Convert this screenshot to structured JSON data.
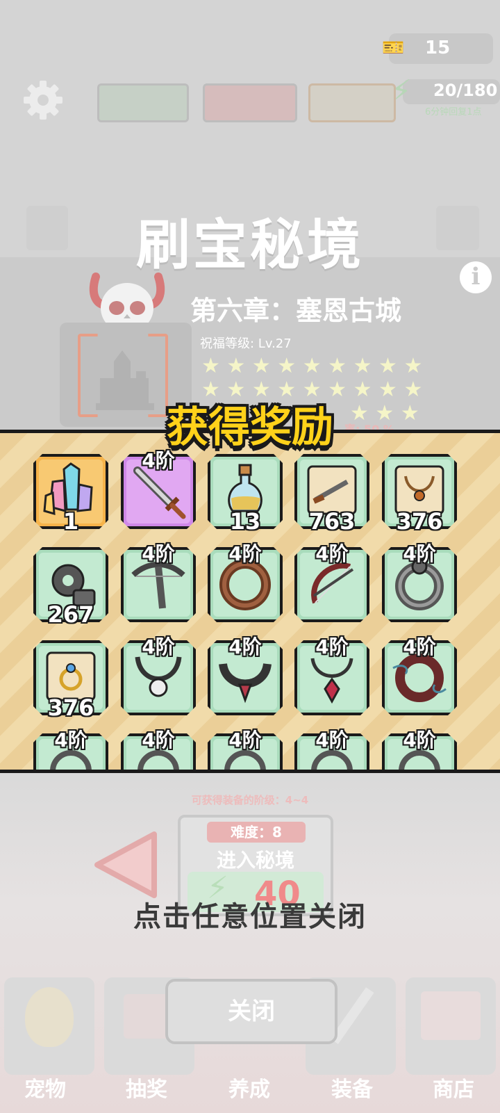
{
  "header": {
    "ticket_count": "15",
    "energy": "20/180",
    "energy_regen": "6分钟回复1点"
  },
  "dungeon": {
    "title": "刷宝秘境",
    "chapter": "第六章：塞恩古城",
    "blessing": "祝福等级: Lv.27",
    "drop_rate_partial": "率: 50 %"
  },
  "reward": {
    "title": "获得奖励",
    "items": [
      {
        "icon": "crystal-cluster-icon",
        "style": "orange",
        "tier": "",
        "count": "1"
      },
      {
        "icon": "sword-icon",
        "style": "purple",
        "tier": "4阶",
        "count": ""
      },
      {
        "icon": "potion-bottle-icon",
        "style": "green",
        "tier": "",
        "count": "13"
      },
      {
        "icon": "dagger-scroll-icon",
        "style": "green",
        "tier": "",
        "count": "763"
      },
      {
        "icon": "necklace-scroll-icon",
        "style": "green",
        "tier": "",
        "count": "376"
      },
      {
        "icon": "gear-material-icon",
        "style": "green",
        "tier": "",
        "count": "267"
      },
      {
        "icon": "crossbow-icon",
        "style": "green",
        "tier": "4阶",
        "count": ""
      },
      {
        "icon": "ring-icon",
        "style": "green",
        "tier": "4阶",
        "count": ""
      },
      {
        "icon": "bow-icon",
        "style": "green",
        "tier": "4阶",
        "count": ""
      },
      {
        "icon": "iron-ring-icon",
        "style": "green",
        "tier": "4阶",
        "count": ""
      },
      {
        "icon": "ring-scroll-icon",
        "style": "green",
        "tier": "",
        "count": "376"
      },
      {
        "icon": "skull-necklace-icon",
        "style": "green",
        "tier": "4阶",
        "count": ""
      },
      {
        "icon": "collar-necklace-icon",
        "style": "green",
        "tier": "4阶",
        "count": ""
      },
      {
        "icon": "ruby-necklace-icon",
        "style": "green",
        "tier": "4阶",
        "count": ""
      },
      {
        "icon": "wind-ring-icon",
        "style": "green",
        "tier": "4阶",
        "count": ""
      },
      {
        "icon": "unknown-item-icon",
        "style": "green",
        "tier": "4阶",
        "count": ""
      },
      {
        "icon": "unknown-item-icon",
        "style": "green",
        "tier": "4阶",
        "count": ""
      },
      {
        "icon": "unknown-item-icon",
        "style": "green",
        "tier": "4阶",
        "count": ""
      },
      {
        "icon": "unknown-item-icon",
        "style": "green",
        "tier": "4阶",
        "count": ""
      },
      {
        "icon": "unknown-item-icon",
        "style": "green",
        "tier": "4阶",
        "count": ""
      }
    ]
  },
  "entry": {
    "grade_range": "可获得装备的阶级：4~4",
    "difficulty": "难度：8",
    "enter_label": "进入秘境",
    "cost": "40"
  },
  "overlay": {
    "close_hint": "点击任意位置关闭",
    "close_button": "关闭"
  },
  "bottom_nav": [
    "宠物",
    "抽奖",
    "养成",
    "装备",
    "商店"
  ],
  "colors": {
    "reward_title": "#ffd21a",
    "panel_bg": "#ebcf98",
    "slot_green": "#a9dcbc",
    "slot_purple": "#cf88e8",
    "slot_orange": "#f6b34a",
    "cost_red": "#f08a8a"
  }
}
